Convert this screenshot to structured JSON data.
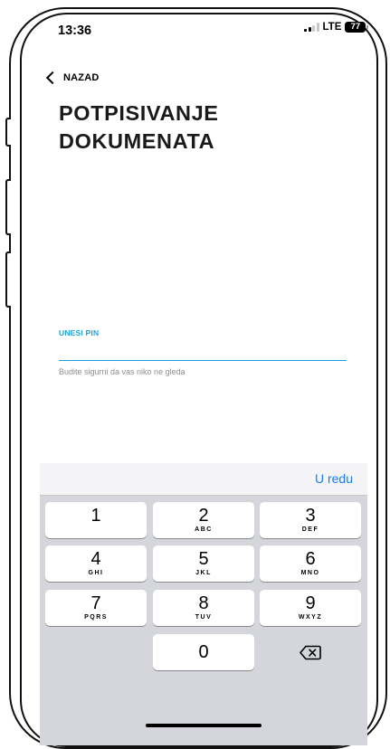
{
  "status_bar": {
    "time": "13:36",
    "network": "LTE",
    "battery": "77"
  },
  "header": {
    "back_label": "NAZAD",
    "title": "POTPISIVANJE DOKUMENATA"
  },
  "pin_field": {
    "label": "UNESI PIN",
    "value": "",
    "hint": "Budite sigurni da vas niko ne gleda"
  },
  "keyboard": {
    "done_label": "U redu",
    "keys": [
      {
        "digit": "1",
        "letters": ""
      },
      {
        "digit": "2",
        "letters": "ABC"
      },
      {
        "digit": "3",
        "letters": "DEF"
      },
      {
        "digit": "4",
        "letters": "GHI"
      },
      {
        "digit": "5",
        "letters": "JKL"
      },
      {
        "digit": "6",
        "letters": "MNO"
      },
      {
        "digit": "7",
        "letters": "PQRS"
      },
      {
        "digit": "8",
        "letters": "TUV"
      },
      {
        "digit": "9",
        "letters": "WXYZ"
      },
      {
        "digit": "0",
        "letters": ""
      }
    ]
  },
  "colors": {
    "accent": "#1ca3dc",
    "keyboard_done": "#1a7cf5",
    "keyboard_bg": "#d4d6dc"
  }
}
